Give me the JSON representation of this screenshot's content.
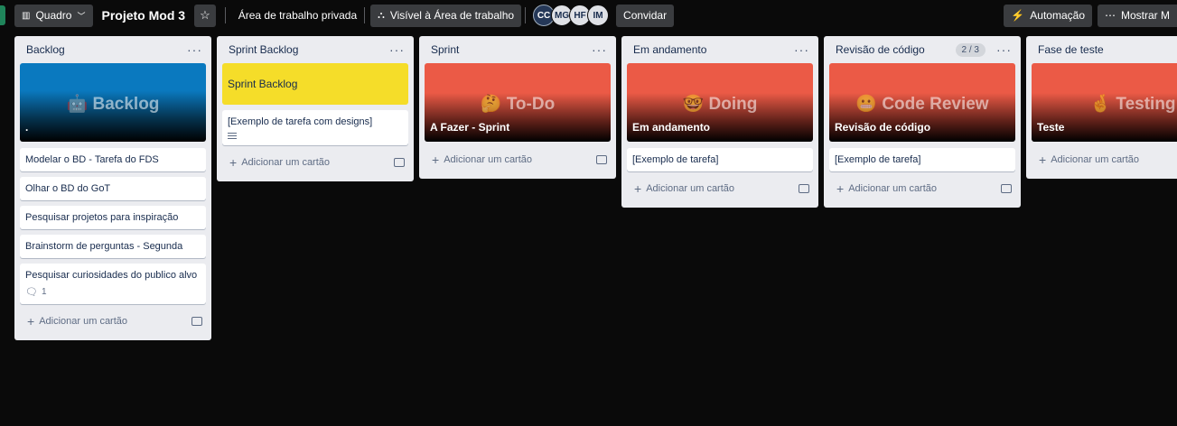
{
  "topbar": {
    "view_label": "Quadro",
    "board_title": "Projeto Mod 3",
    "workspace": "Área de trabalho privada",
    "visibility": "Visível à Área de trabalho",
    "members": [
      "CC",
      "MG",
      "HF",
      "IM"
    ],
    "invite": "Convidar",
    "automation": "Automação",
    "show_menu": "Mostrar M"
  },
  "add_card_label": "Adicionar um cartão",
  "lists": {
    "backlog": {
      "title": "Backlog",
      "cover_big": "🤖 Backlog",
      "cover_label": ".",
      "cards": [
        "Modelar o BD - Tarefa do FDS",
        "Olhar o BD do GoT",
        "Pesquisar projetos para inspiração",
        "Brainstorm de perguntas - Segunda",
        "Pesquisar curiosidades do publico alvo"
      ],
      "comment_count": "1"
    },
    "sprint_backlog": {
      "title": "Sprint Backlog",
      "cover_label": "Sprint Backlog",
      "cards": [
        "[Exemplo de tarefa com designs]"
      ]
    },
    "sprint": {
      "title": "Sprint",
      "cover_big": "🤔 To-Do",
      "cover_label": "A Fazer - Sprint"
    },
    "in_progress": {
      "title": "Em andamento",
      "cover_big": "🤓 Doing",
      "cover_label": "Em andamento",
      "cards": [
        "[Exemplo de tarefa]"
      ]
    },
    "code_review": {
      "title": "Revisão de código",
      "count": "2 / 3",
      "cover_big": "😬 Code Review",
      "cover_label": "Revisão de código",
      "cards": [
        "[Exemplo de tarefa]"
      ]
    },
    "testing": {
      "title": "Fase de teste",
      "cover_big": "🤞 Testing",
      "cover_label": "Teste"
    }
  },
  "colors": {
    "cover_blue": "#0a79bf",
    "cover_red": "#eb5a46",
    "cover_yellow": "#f5dd29",
    "list_bg": "#ebecf0"
  }
}
